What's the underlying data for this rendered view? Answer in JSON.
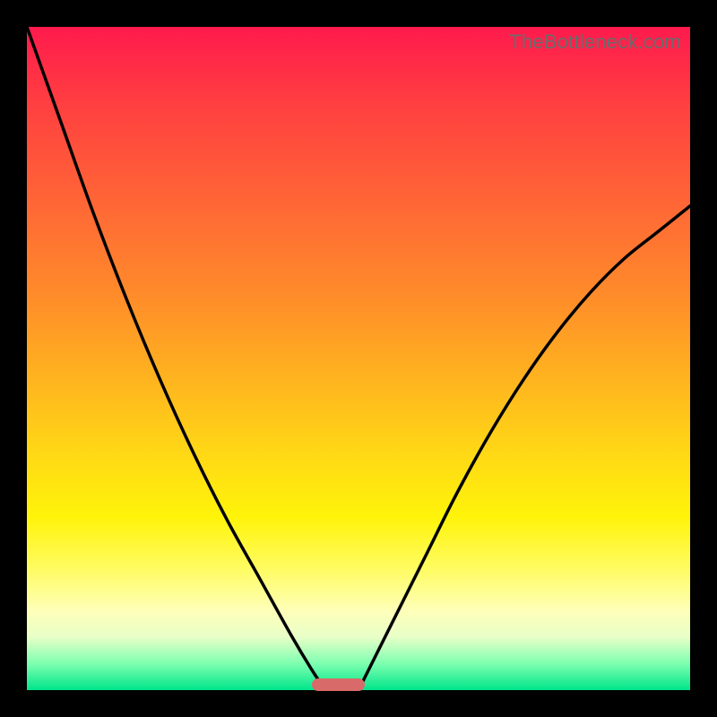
{
  "watermark": "TheBottleneck.com",
  "chart_data": {
    "type": "line",
    "title": "",
    "xlabel": "",
    "ylabel": "",
    "xlim": [
      0,
      100
    ],
    "ylim": [
      0,
      100
    ],
    "grid": false,
    "legend": false,
    "series": [
      {
        "name": "left-curve",
        "x": [
          0,
          5,
          10,
          15,
          20,
          25,
          30,
          35,
          40,
          43,
          45
        ],
        "y": [
          100,
          86,
          72,
          59,
          47,
          36,
          26,
          17,
          8,
          3,
          0
        ]
      },
      {
        "name": "right-curve",
        "x": [
          50,
          52,
          55,
          60,
          65,
          70,
          75,
          80,
          85,
          90,
          95,
          100
        ],
        "y": [
          0,
          4,
          10,
          20,
          30,
          39,
          47,
          54,
          60,
          65,
          69,
          73
        ]
      }
    ],
    "marker": {
      "x_start": 43,
      "x_end": 51,
      "color": "#d96a6a"
    },
    "gradient_stops": [
      {
        "pos": 0,
        "color": "#ff1a4d"
      },
      {
        "pos": 50,
        "color": "#ffd716"
      },
      {
        "pos": 90,
        "color": "#feffb8"
      },
      {
        "pos": 100,
        "color": "#00e58a"
      }
    ]
  }
}
